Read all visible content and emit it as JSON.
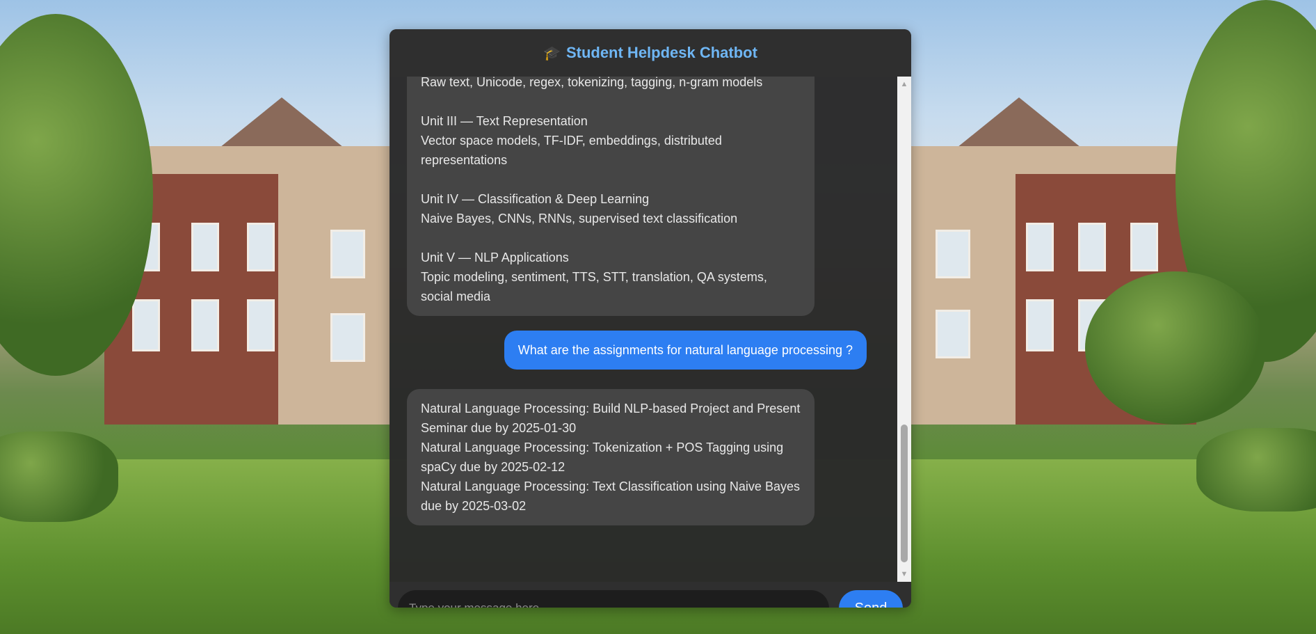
{
  "header": {
    "icon": "graduation-cap-icon",
    "title": "Student Helpdesk Chatbot"
  },
  "messages": [
    {
      "role": "bot",
      "text": "Raw text, Unicode, regex, tokenizing, tagging, n-gram models\n\nUnit III — Text Representation\nVector space models, TF-IDF, embeddings, distributed representations\n\nUnit IV — Classification & Deep Learning\nNaive Bayes, CNNs, RNNs, supervised text classification\n\nUnit V — NLP Applications\nTopic modeling, sentiment, TTS, STT, translation, QA systems, social media"
    },
    {
      "role": "user",
      "text": "What are the assignments for natural language processing ?"
    },
    {
      "role": "bot",
      "text": "Natural Language Processing: Build NLP-based Project and Present Seminar due by 2025-01-30\nNatural Language Processing: Tokenization + POS Tagging using spaCy due by 2025-02-12\nNatural Language Processing: Text Classification using Naive Bayes due by 2025-03-02"
    }
  ],
  "input": {
    "placeholder": "Type your message here...",
    "value": ""
  },
  "send_label": "Send",
  "colors": {
    "accent": "#2d7ef2",
    "header_title": "#6fb6f4",
    "panel": "#2f2f2f",
    "bot_bubble": "#454545"
  }
}
